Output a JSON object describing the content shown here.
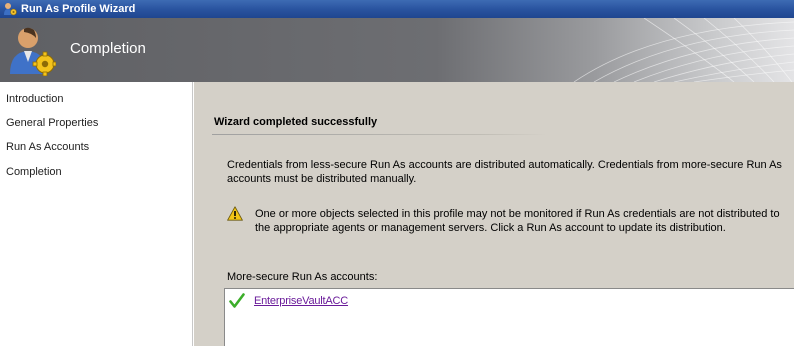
{
  "window": {
    "title": "Run As Profile Wizard"
  },
  "header": {
    "title": "Completion"
  },
  "nav": {
    "items": [
      {
        "label": "Introduction"
      },
      {
        "label": "General Properties"
      },
      {
        "label": "Run As Accounts"
      },
      {
        "label": "Completion"
      }
    ]
  },
  "main": {
    "heading": "Wizard completed successfully",
    "description": "Credentials from less-secure Run As accounts are distributed automatically. Credentials from more-secure Run As accounts must be distributed manually.",
    "warning": "One or more objects selected in this profile may not be monitored if Run As credentials are not distributed to the appropriate agents or management servers. Click a Run As account to update its distribution.",
    "accounts_label": "More-secure Run As accounts:",
    "accounts": [
      {
        "name": "EnterpriseVaultACC",
        "status_icon": "check-icon"
      }
    ]
  },
  "icons": {
    "app": "wizard-app-icon",
    "header": "user-gear-icon",
    "warning": "warning-icon"
  },
  "colors": {
    "titlebar": "#2a54a0",
    "content_bg": "#d4d0c8",
    "link": "#6a1b9a",
    "check": "#3cae2a",
    "warning": "#f3c516"
  }
}
